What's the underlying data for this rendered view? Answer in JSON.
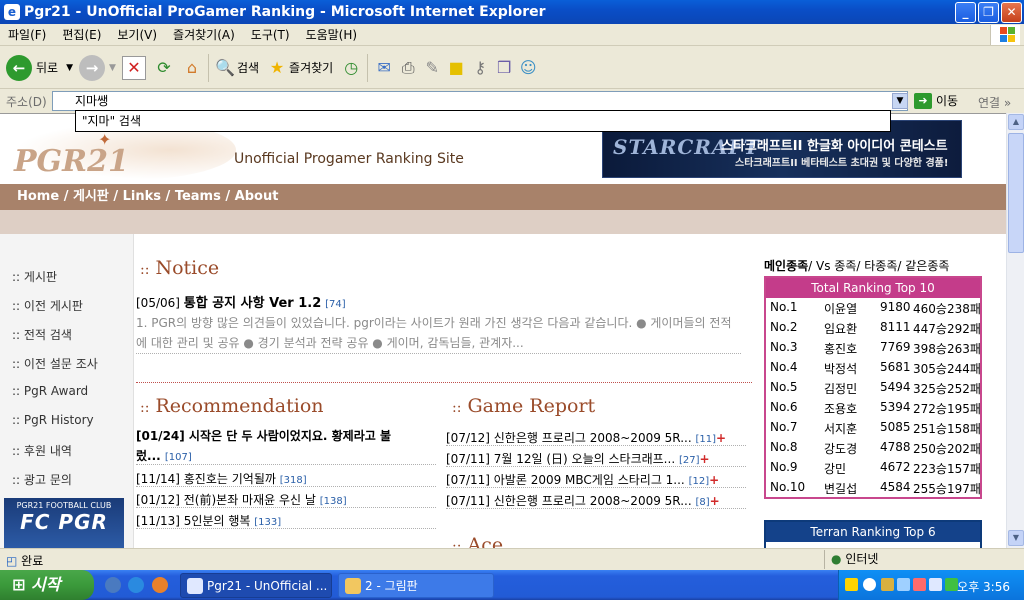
{
  "window": {
    "title": "Pgr21 - UnOfficial ProGamer Ranking - Microsoft Internet Explorer"
  },
  "menu": [
    "파일(F)",
    "편집(E)",
    "보기(V)",
    "즐겨찾기(A)",
    "도구(T)",
    "도움말(H)"
  ],
  "toolbar": {
    "back_label": "뒤로",
    "search_label": "검색",
    "favorites_label": "즐겨찾기"
  },
  "address": {
    "label": "주소(D)",
    "value": "지마쌩",
    "suggestion": "\"지마\" 검색",
    "go_label": "이동",
    "links_label": "연결"
  },
  "site": {
    "logo": "PGR21",
    "tagline": "Unofficial Progamer Ranking Site",
    "banner": {
      "brand": "STARCRAFT",
      "line1": "스타크래프트II 한글화 아이디어 콘테스트",
      "line2": "스타크래프트II 베타테스트 초대권 및 다양한 경품!"
    },
    "nav": "Home / 게시판 / Links / Teams / About"
  },
  "leftnav": [
    "게시판",
    "이전 게시판",
    "전적 검색",
    "이전 설문 조사",
    "PgR Award",
    "PgR History",
    "후원 내역",
    "광고 문의"
  ],
  "leftnav_prefix": "::",
  "fc_logo": {
    "small": "PGR21 FOOTBALL CLUB",
    "big": "FC PGR"
  },
  "notice": {
    "title": "Notice",
    "date": "[05/06]",
    "headline": "통합 공지 사항 Ver 1.2",
    "count": "[74]",
    "body": "1. PGR의 방향 많은 의견들이 있었습니다. pgr이라는 사이트가 원래 가진 생각은 다음과 같습니다. ● 게이머들의 전적에 대한 관리 및 공유 ● 경기 분석과 전략 공유 ● 게이머, 감독님들, 관계자..."
  },
  "recommendation": {
    "title": "Recommendation",
    "items": [
      {
        "text": "[01/24] 시작은 단 두 사람이었지요. 황제라고 불",
        "line2": "렀...",
        "count": "[107]"
      },
      {
        "text": "[11/14] 홍진호는 기억될까",
        "count": "[318]"
      },
      {
        "text": "[01/12] 전(前)본좌 마재윤 우신 날",
        "count": "[138]"
      },
      {
        "text": "[11/13] 5인분의 행복",
        "count": "[133]"
      }
    ]
  },
  "game_report": {
    "title": "Game Report",
    "items": [
      {
        "text": "[07/12] 신한은행 프로리그 2008~2009 5R...",
        "count": "[11]"
      },
      {
        "text": "[07/11] 7월 12일 (日) 오늘의 스타크래프...",
        "count": "[27]"
      },
      {
        "text": "[07/11] 아발론 2009 MBC게임 스타리그 1...",
        "count": "[12]"
      },
      {
        "text": "[07/11] 신한은행 프로리그 2008~2009 5R...",
        "count": "[8]"
      }
    ],
    "plus": "+"
  },
  "ace": {
    "title": "Ace"
  },
  "ranking": {
    "tabs": [
      "메인종족",
      "Vs 종족",
      "타종족",
      "같은종족"
    ],
    "box_title": "Total Ranking Top 10",
    "rows": [
      {
        "rank": "No.1",
        "name": "이윤열",
        "score": "9180",
        "rec": "460승238패"
      },
      {
        "rank": "No.2",
        "name": "임요환",
        "score": "8111",
        "rec": "447승292패"
      },
      {
        "rank": "No.3",
        "name": "홍진호",
        "score": "7769",
        "rec": "398승263패"
      },
      {
        "rank": "No.4",
        "name": "박정석",
        "score": "5681",
        "rec": "305승244패"
      },
      {
        "rank": "No.5",
        "name": "김정민",
        "score": "5494",
        "rec": "325승252패"
      },
      {
        "rank": "No.6",
        "name": "조용호",
        "score": "5394",
        "rec": "272승195패"
      },
      {
        "rank": "No.7",
        "name": "서지훈",
        "score": "5085",
        "rec": "251승158패"
      },
      {
        "rank": "No.8",
        "name": "강도경",
        "score": "4788",
        "rec": "250승202패"
      },
      {
        "rank": "No.9",
        "name": "강민",
        "score": "4672",
        "rec": "223승157패"
      },
      {
        "rank": "No.10",
        "name": "변길섭",
        "score": "4584",
        "rec": "255승197패"
      }
    ],
    "terran_title": "Terran Ranking Top 6"
  },
  "status": {
    "text": "완료",
    "zone": "인터넷"
  },
  "taskbar": {
    "start": "시작",
    "tasks": [
      "Pgr21 - UnOfficial ...",
      "2 - 그림판"
    ],
    "clock": "오후 3:56"
  },
  "colors": {
    "nav_bar": "#a8826a",
    "rank_box": "#c43c8a",
    "terran_box": "#14428a",
    "section_title": "#9a4b2a"
  }
}
